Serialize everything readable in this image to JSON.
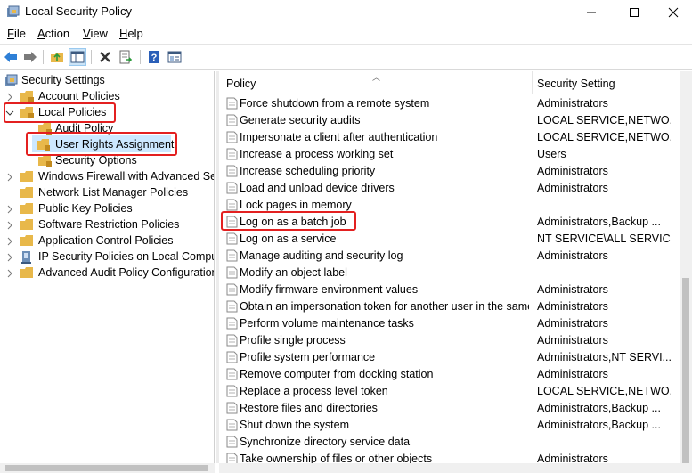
{
  "window": {
    "title": "Local Security Policy"
  },
  "menu": {
    "file": "F",
    "file_rest": "ile",
    "action": "A",
    "action_rest": "ction",
    "view": "V",
    "view_rest": "iew",
    "help": "H",
    "help_rest": "elp"
  },
  "tree": {
    "root": "Security Settings",
    "items": [
      "Account Policies",
      "Local Policies",
      "Audit Policy",
      "User Rights Assignment",
      "Security Options",
      "Windows Firewall with Advanced Security",
      "Network List Manager Policies",
      "Public Key Policies",
      "Software Restriction Policies",
      "Application Control Policies",
      "IP Security Policies on Local Computer",
      "Advanced Audit Policy Configuration"
    ]
  },
  "list": {
    "columns": {
      "policy": "Policy",
      "setting": "Security Setting"
    },
    "rows": [
      {
        "policy": "Force shutdown from a remote system",
        "setting": "Administrators"
      },
      {
        "policy": "Generate security audits",
        "setting": "LOCAL SERVICE,NETWO..."
      },
      {
        "policy": "Impersonate a client after authentication",
        "setting": "LOCAL SERVICE,NETWO..."
      },
      {
        "policy": "Increase a process working set",
        "setting": "Users"
      },
      {
        "policy": "Increase scheduling priority",
        "setting": "Administrators"
      },
      {
        "policy": "Load and unload device drivers",
        "setting": "Administrators"
      },
      {
        "policy": "Lock pages in memory",
        "setting": ""
      },
      {
        "policy": "Log on as a batch job",
        "setting": "Administrators,Backup ..."
      },
      {
        "policy": "Log on as a service",
        "setting": "NT SERVICE\\ALL SERVIC..."
      },
      {
        "policy": "Manage auditing and security log",
        "setting": "Administrators"
      },
      {
        "policy": "Modify an object label",
        "setting": ""
      },
      {
        "policy": "Modify firmware environment values",
        "setting": "Administrators"
      },
      {
        "policy": "Obtain an impersonation token for another user in the same...",
        "setting": "Administrators"
      },
      {
        "policy": "Perform volume maintenance tasks",
        "setting": "Administrators"
      },
      {
        "policy": "Profile single process",
        "setting": "Administrators"
      },
      {
        "policy": "Profile system performance",
        "setting": "Administrators,NT SERVI..."
      },
      {
        "policy": "Remove computer from docking station",
        "setting": "Administrators"
      },
      {
        "policy": "Replace a process level token",
        "setting": "LOCAL SERVICE,NETWO..."
      },
      {
        "policy": "Restore files and directories",
        "setting": "Administrators,Backup ..."
      },
      {
        "policy": "Shut down the system",
        "setting": "Administrators,Backup ..."
      },
      {
        "policy": "Synchronize directory service data",
        "setting": ""
      },
      {
        "policy": "Take ownership of files or other objects",
        "setting": "Administrators"
      }
    ]
  },
  "colors": {
    "highlight": "#e32020",
    "selection": "#cce8ff",
    "folder": "#e8b84a"
  }
}
